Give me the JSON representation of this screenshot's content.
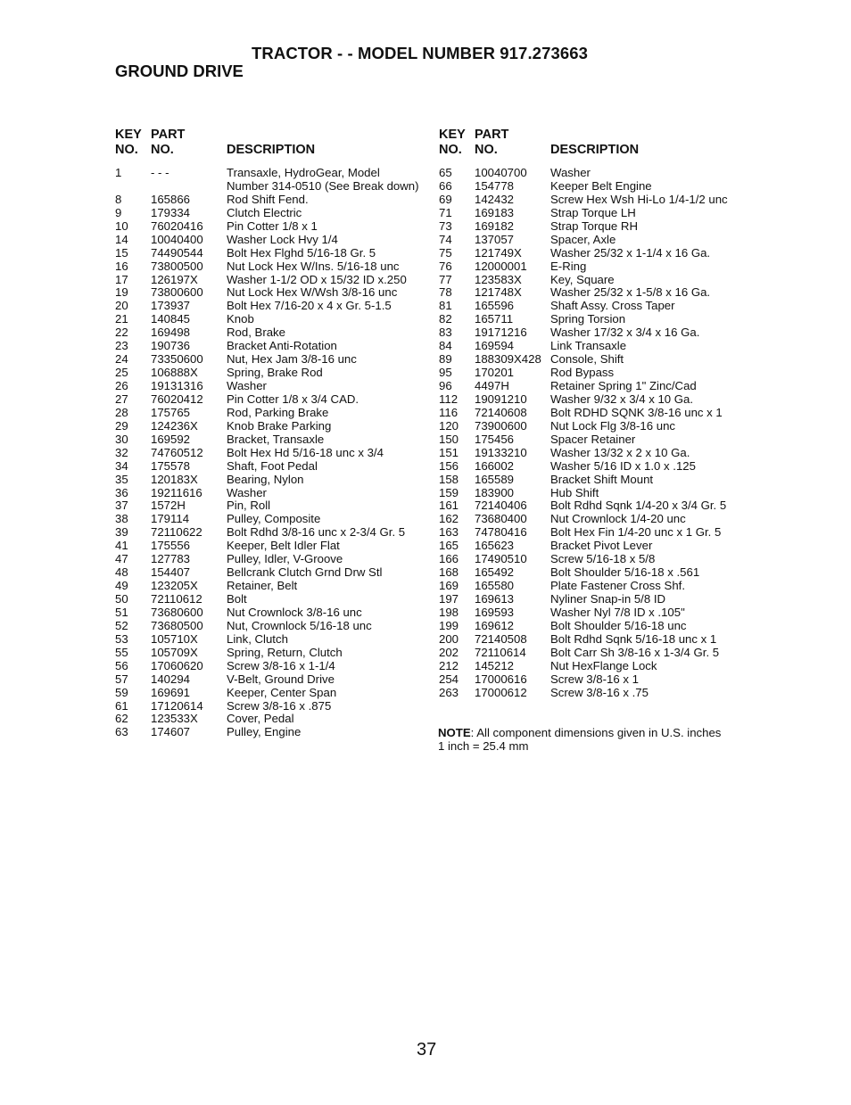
{
  "header": {
    "title": "TRACTOR - - MODEL NUMBER 917.273663",
    "section": "GROUND DRIVE"
  },
  "table_headers": {
    "key_line1": "KEY",
    "key_line2": "NO.",
    "part_line1": "PART",
    "part_line2": "NO.",
    "description": "DESCRIPTION"
  },
  "left_parts": [
    {
      "key": "1",
      "part": "- - -",
      "desc": "Transaxle, HydroGear, Model Number 314-0510 (See Break down)"
    },
    {
      "key": "8",
      "part": "165866",
      "desc": "Rod Shift Fend."
    },
    {
      "key": "9",
      "part": "179334",
      "desc": "Clutch Electric"
    },
    {
      "key": "10",
      "part": "76020416",
      "desc": "Pin Cotter 1/8 x 1"
    },
    {
      "key": "14",
      "part": "10040400",
      "desc": "Washer Lock Hvy 1/4"
    },
    {
      "key": "15",
      "part": "74490544",
      "desc": "Bolt Hex Flghd 5/16-18 Gr. 5"
    },
    {
      "key": "16",
      "part": "73800500",
      "desc": "Nut Lock Hex W/Ins. 5/16-18 unc"
    },
    {
      "key": "17",
      "part": "126197X",
      "desc": "Washer 1-1/2 OD x 15/32 ID x.250"
    },
    {
      "key": "19",
      "part": "73800600",
      "desc": "Nut Lock Hex W/Wsh  3/8-16 unc"
    },
    {
      "key": "20",
      "part": "173937",
      "desc": "Bolt Hex 7/16-20 x 4 x Gr. 5-1.5"
    },
    {
      "key": "21",
      "part": "140845",
      "desc": "Knob"
    },
    {
      "key": "22",
      "part": "169498",
      "desc": "Rod, Brake"
    },
    {
      "key": "23",
      "part": "190736",
      "desc": "Bracket Anti-Rotation"
    },
    {
      "key": "24",
      "part": "73350600",
      "desc": "Nut, Hex Jam  3/8-16 unc"
    },
    {
      "key": "25",
      "part": "106888X",
      "desc": "Spring, Brake Rod"
    },
    {
      "key": "26",
      "part": "19131316",
      "desc": "Washer"
    },
    {
      "key": "27",
      "part": "76020412",
      "desc": "Pin Cotter  1/8 x 3/4 CAD."
    },
    {
      "key": "28",
      "part": "175765",
      "desc": "Rod, Parking Brake"
    },
    {
      "key": "29",
      "part": "124236X",
      "desc": "Knob Brake Parking"
    },
    {
      "key": "30",
      "part": "169592",
      "desc": "Bracket, Transaxle"
    },
    {
      "key": "32",
      "part": "74760512",
      "desc": "Bolt Hex Hd  5/16-18 unc x 3/4"
    },
    {
      "key": "34",
      "part": "175578",
      "desc": "Shaft, Foot Pedal"
    },
    {
      "key": "35",
      "part": "120183X",
      "desc": "Bearing, Nylon"
    },
    {
      "key": "36",
      "part": "19211616",
      "desc": "Washer"
    },
    {
      "key": "37",
      "part": "1572H",
      "desc": "Pin, Roll"
    },
    {
      "key": "38",
      "part": "179114",
      "desc": "Pulley, Composite"
    },
    {
      "key": "39",
      "part": "72110622",
      "desc": "Bolt Rdhd 3/8-16 unc x 2-3/4 Gr. 5"
    },
    {
      "key": "41",
      "part": "175556",
      "desc": "Keeper, Belt Idler Flat"
    },
    {
      "key": "47",
      "part": "127783",
      "desc": "Pulley, Idler, V-Groove"
    },
    {
      "key": "48",
      "part": "154407",
      "desc": "Bellcrank Clutch Grnd Drw Stl"
    },
    {
      "key": "49",
      "part": "123205X",
      "desc": "Retainer, Belt"
    },
    {
      "key": "50",
      "part": "72110612",
      "desc": "Bolt"
    },
    {
      "key": "51",
      "part": "73680600",
      "desc": "Nut Crownlock  3/8-16 unc"
    },
    {
      "key": "52",
      "part": "73680500",
      "desc": "Nut, Crownlock  5/16-18 unc"
    },
    {
      "key": "53",
      "part": "105710X",
      "desc": "Link, Clutch"
    },
    {
      "key": "55",
      "part": "105709X",
      "desc": "Spring, Return, Clutch"
    },
    {
      "key": "56",
      "part": "17060620",
      "desc": "Screw 3/8-16 x 1-1/4"
    },
    {
      "key": "57",
      "part": "140294",
      "desc": "V-Belt, Ground Drive"
    },
    {
      "key": "59",
      "part": "169691",
      "desc": "Keeper, Center Span"
    },
    {
      "key": "61",
      "part": "17120614",
      "desc": "Screw 3/8-16 x .875"
    },
    {
      "key": "62",
      "part": "123533X",
      "desc": "Cover, Pedal"
    },
    {
      "key": "63",
      "part": "174607",
      "desc": "Pulley, Engine"
    }
  ],
  "right_parts": [
    {
      "key": "65",
      "part": "10040700",
      "desc": "Washer"
    },
    {
      "key": "66",
      "part": "154778",
      "desc": "Keeper Belt Engine"
    },
    {
      "key": "69",
      "part": "142432",
      "desc": "Screw Hex Wsh Hi-Lo 1/4-1/2 unc"
    },
    {
      "key": "71",
      "part": "169183",
      "desc": "Strap Torque LH"
    },
    {
      "key": "73",
      "part": "169182",
      "desc": "Strap Torque RH"
    },
    {
      "key": "74",
      "part": "137057",
      "desc": "Spacer, Axle"
    },
    {
      "key": "75",
      "part": "121749X",
      "desc": "Washer  25/32 x 1-1/4 x 16 Ga."
    },
    {
      "key": "76",
      "part": "12000001",
      "desc": "E-Ring"
    },
    {
      "key": "77",
      "part": "123583X",
      "desc": "Key, Square"
    },
    {
      "key": "78",
      "part": "121748X",
      "desc": "Washer  25/32 x 1-5/8 x 16 Ga."
    },
    {
      "key": "81",
      "part": "165596",
      "desc": "Shaft Assy. Cross Taper"
    },
    {
      "key": "82",
      "part": "165711",
      "desc": "Spring Torsion"
    },
    {
      "key": "83",
      "part": "19171216",
      "desc": "Washer 17/32 x 3/4 x 16 Ga."
    },
    {
      "key": "84",
      "part": "169594",
      "desc": "Link Transaxle"
    },
    {
      "key": "89",
      "part": "188309X428",
      "desc": "Console, Shift"
    },
    {
      "key": "95",
      "part": "170201",
      "desc": "Rod Bypass"
    },
    {
      "key": "96",
      "part": "4497H",
      "desc": "Retainer Spring 1\" Zinc/Cad"
    },
    {
      "key": "112",
      "part": "19091210",
      "desc": "Washer 9/32 x 3/4 x 10 Ga."
    },
    {
      "key": "116",
      "part": "72140608",
      "desc": "Bolt RDHD SQNK 3/8-16 unc x 1"
    },
    {
      "key": "120",
      "part": "73900600",
      "desc": "Nut Lock Flg 3/8-16 unc"
    },
    {
      "key": "150",
      "part": "175456",
      "desc": "Spacer Retainer"
    },
    {
      "key": "151",
      "part": "19133210",
      "desc": "Washer 13/32 x 2 x 10 Ga."
    },
    {
      "key": "156",
      "part": "166002",
      "desc": "Washer 5/16 ID x 1.0 x .125"
    },
    {
      "key": "158",
      "part": "165589",
      "desc": "Bracket Shift Mount"
    },
    {
      "key": "159",
      "part": "183900",
      "desc": "Hub Shift"
    },
    {
      "key": "161",
      "part": "72140406",
      "desc": "Bolt Rdhd Sqnk 1/4-20 x 3/4 Gr. 5"
    },
    {
      "key": "162",
      "part": "73680400",
      "desc": "Nut Crownlock 1/4-20 unc"
    },
    {
      "key": "163",
      "part": "74780416",
      "desc": "Bolt Hex Fin 1/4-20 unc x 1 Gr. 5"
    },
    {
      "key": "165",
      "part": "165623",
      "desc": "Bracket Pivot Lever"
    },
    {
      "key": "166",
      "part": "17490510",
      "desc": "Screw 5/16-18 x 5/8"
    },
    {
      "key": "168",
      "part": "165492",
      "desc": "Bolt Shoulder 5/16-18 x .561"
    },
    {
      "key": "169",
      "part": "165580",
      "desc": "Plate Fastener Cross Shf."
    },
    {
      "key": "197",
      "part": "169613",
      "desc": "Nyliner Snap-in 5/8 ID"
    },
    {
      "key": "198",
      "part": "169593",
      "desc": "Washer Nyl 7/8 ID x .105\""
    },
    {
      "key": "199",
      "part": "169612",
      "desc": "Bolt Shoulder 5/16-18 unc"
    },
    {
      "key": "200",
      "part": "72140508",
      "desc": "Bolt Rdhd Sqnk 5/16-18 unc x 1"
    },
    {
      "key": "202",
      "part": "72110614",
      "desc": "Bolt Carr Sh 3/8-16 x 1-3/4 Gr. 5"
    },
    {
      "key": "212",
      "part": "145212",
      "desc": "Nut HexFlange Lock"
    },
    {
      "key": "254",
      "part": "17000616",
      "desc": "Screw 3/8-16 x 1"
    },
    {
      "key": "263",
      "part": "17000612",
      "desc": "Screw 3/8-16 x .75"
    }
  ],
  "note": {
    "label": "NOTE",
    "text": ": All component dimensions given in U.S. inches",
    "line2": "1 inch = 25.4 mm"
  },
  "page_number": "37"
}
